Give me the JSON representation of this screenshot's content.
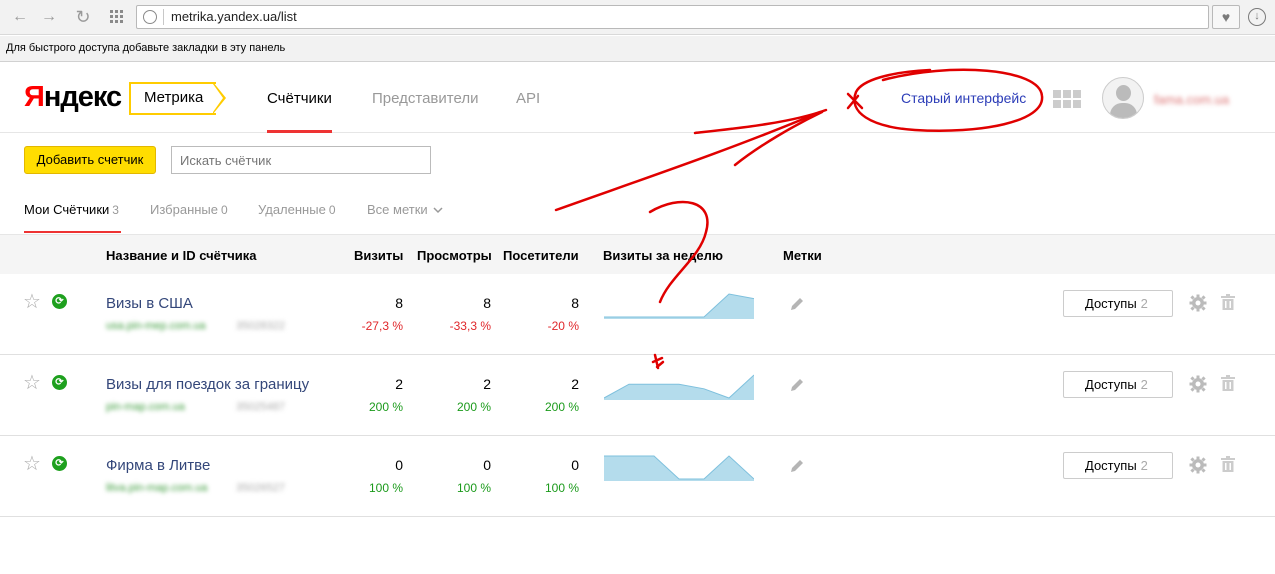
{
  "browser": {
    "url": "metrika.yandex.ua/list",
    "bookmarks_hint": "Для быстрого доступа добавьте закладки в эту панель"
  },
  "header": {
    "logo_first": "Я",
    "logo_rest": "ндекс",
    "product": "Метрика",
    "tabs": [
      {
        "label": "Счётчики",
        "active": true
      },
      {
        "label": "Представители",
        "active": false
      },
      {
        "label": "API",
        "active": false
      }
    ],
    "old_interface": "Старый интерфейс",
    "user_name": "fama.com.ua"
  },
  "toolbar": {
    "add_label": "Добавить счетчик",
    "search_placeholder": "Искать счётчик"
  },
  "subtabs": [
    {
      "label": "Мои Счётчики",
      "count": "3",
      "active": true
    },
    {
      "label": "Избранные",
      "count": "0",
      "active": false
    },
    {
      "label": "Удаленные",
      "count": "0",
      "active": false
    },
    {
      "label": "Все метки",
      "count": "",
      "active": false
    }
  ],
  "table": {
    "headers": {
      "name": "Название и ID счётчика",
      "visits": "Визиты",
      "views": "Просмотры",
      "visitors": "Посетители",
      "week": "Визиты за неделю",
      "tags": "Метки"
    },
    "rows": [
      {
        "name": "Визы в США",
        "domain": "usa.pin-mep.com.ua",
        "id": "35028322",
        "visits": "8",
        "visits_pct": "-27,3 %",
        "views": "8",
        "views_pct": "-33,3 %",
        "visitors": "8",
        "visitors_pct": "-20 %",
        "trend": "neg",
        "week": [
          0,
          0,
          0,
          0,
          0,
          1,
          0.8
        ],
        "access_label": "Доступы",
        "access_count": "2"
      },
      {
        "name": "Визы для поездок за границу",
        "domain": "pin-map.com.ua",
        "id": "35025487",
        "visits": "2",
        "visits_pct": "200 %",
        "views": "2",
        "views_pct": "200 %",
        "visitors": "2",
        "visitors_pct": "200 %",
        "trend": "pos",
        "week": [
          0,
          0.6,
          0.6,
          0.6,
          0.4,
          0,
          1
        ],
        "access_label": "Доступы",
        "access_count": "2"
      },
      {
        "name": "Фирма в Литве",
        "domain": "litva.pin-map.com.ua",
        "id": "35026527",
        "visits": "0",
        "visits_pct": "100 %",
        "views": "0",
        "views_pct": "100 %",
        "visitors": "0",
        "visitors_pct": "100 %",
        "trend": "pos",
        "week": [
          1,
          1,
          1,
          0,
          0,
          1,
          0
        ],
        "access_label": "Доступы",
        "access_count": "2"
      }
    ]
  },
  "colors": {
    "accent_red": "#ee3333",
    "brand_yellow": "#ffdd00",
    "link_blue": "#2c3db8",
    "spark_fill": "#b4dcec",
    "spark_line": "#7ec0dd",
    "annotation": "#e00000"
  }
}
